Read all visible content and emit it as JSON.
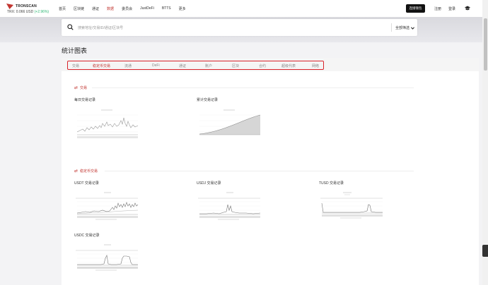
{
  "brand": {
    "name": "TRONSCAN",
    "price_label": "TRX: 0.066 USD",
    "price_change": "(+2.96%)"
  },
  "nav": {
    "items": [
      {
        "label": "首页"
      },
      {
        "label": "区块链"
      },
      {
        "label": "通证"
      },
      {
        "label": "数据"
      },
      {
        "label": "委员会"
      },
      {
        "label": "JustDeFi"
      },
      {
        "label": "BTTS"
      },
      {
        "label": "更多"
      }
    ],
    "wallet_button": "连接钱包",
    "register": "注册",
    "login": "登录"
  },
  "search": {
    "placeholder": "搜索地址/交易ID/通证/区块号",
    "filter": "全部筛选"
  },
  "page_title": "统计图表",
  "tabs": [
    {
      "label": "交易"
    },
    {
      "label": "稳定币交易"
    },
    {
      "label": "流通"
    },
    {
      "label": "DeFi"
    },
    {
      "label": "通证"
    },
    {
      "label": "账户"
    },
    {
      "label": "区块"
    },
    {
      "label": "合约"
    },
    {
      "label": "超级代表"
    },
    {
      "label": "网络"
    }
  ],
  "sections": {
    "transactions": {
      "title": "交易",
      "charts": [
        {
          "label": "每日交易记录"
        },
        {
          "label": "累计交易记录"
        }
      ]
    },
    "stablecoin": {
      "title": "稳定币交易",
      "charts": [
        {
          "label": "USDT 交易记录"
        },
        {
          "label": "USDJ 交易记录"
        },
        {
          "label": "TUSD 交易记录"
        },
        {
          "label": "USDC 交易记录"
        }
      ]
    }
  },
  "colors": {
    "accent": "#c23631",
    "tab_border": "#d9222a",
    "positive": "#2bb673"
  }
}
